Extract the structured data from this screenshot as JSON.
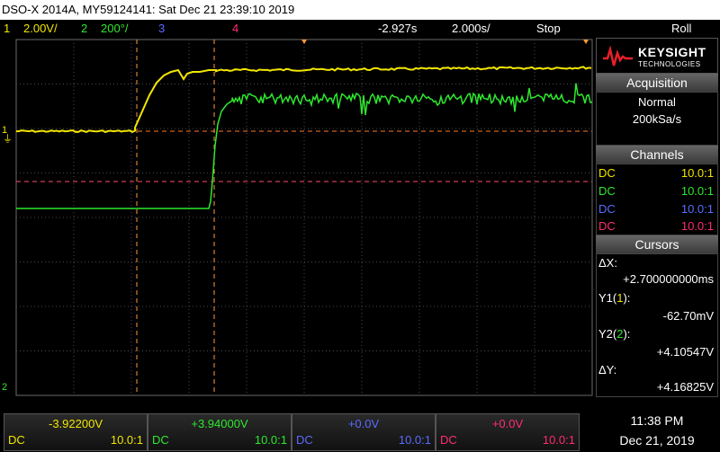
{
  "title_bar": {
    "text": "DSO-X 2014A, MY59124141: Sat Dec 21 23:39:10 2019"
  },
  "status": {
    "ch1_num": "1",
    "ch1_scale": "2.00V/",
    "ch2_num": "2",
    "ch2_scale": "200°/",
    "ch3_num": "3",
    "ch4_num": "4",
    "time_delay": "-2.927s",
    "time_scale": "2.000s/",
    "run_state": "Stop",
    "mode": "Roll"
  },
  "logo": {
    "brand": "KEYSIGHT",
    "sub": "TECHNOLOGIES"
  },
  "acquisition": {
    "header": "Acquisition",
    "mode": "Normal",
    "rate": "200kSa/s"
  },
  "channels": {
    "header": "Channels",
    "rows": [
      {
        "coupling": "DC",
        "probe": "10.0:1",
        "color": "#f2e600"
      },
      {
        "coupling": "DC",
        "probe": "10.0:1",
        "color": "#2ee82e"
      },
      {
        "coupling": "DC",
        "probe": "10.0:1",
        "color": "#5a6cff"
      },
      {
        "coupling": "DC",
        "probe": "10.0:1",
        "color": "#ff2d6e"
      }
    ]
  },
  "cursors": {
    "header": "Cursors",
    "dx_label": "ΔX:",
    "dx_value": "+2.700000000ms",
    "y1_label": "Y1(",
    "y1_ch": "1",
    "y1_end": "):",
    "y1_value": "-62.70mV",
    "y2_label": "Y2(",
    "y2_ch": "2",
    "y2_end": "):",
    "y2_value": "+4.10547V",
    "dy_label": "ΔY:",
    "dy_value": "+4.16825V"
  },
  "markers": {
    "ch1": "1",
    "ch2": "2",
    "ground": "⏚"
  },
  "bottom_channels": [
    {
      "offset": "-3.92200V",
      "coupling": "DC",
      "probe": "10.0:1",
      "color": "#f2e600"
    },
    {
      "offset": "+3.94000V",
      "coupling": "DC",
      "probe": "10.0:1",
      "color": "#2ee82e"
    },
    {
      "offset": "+0.0V",
      "coupling": "DC",
      "probe": "10.0:1",
      "color": "#5a6cff"
    },
    {
      "offset": "+0.0V",
      "coupling": "DC",
      "probe": "10.0:1",
      "color": "#ff2d6e"
    }
  ],
  "clock": {
    "time": "11:38 PM",
    "date": "Dec 21, 2019"
  },
  "colors": {
    "ch1": "#f2e600",
    "ch2": "#2ee82e",
    "ch3": "#5a6cff",
    "ch4": "#ff2d6e",
    "cursor": "#ff9a3c",
    "grid": "#6a6a6a"
  }
}
